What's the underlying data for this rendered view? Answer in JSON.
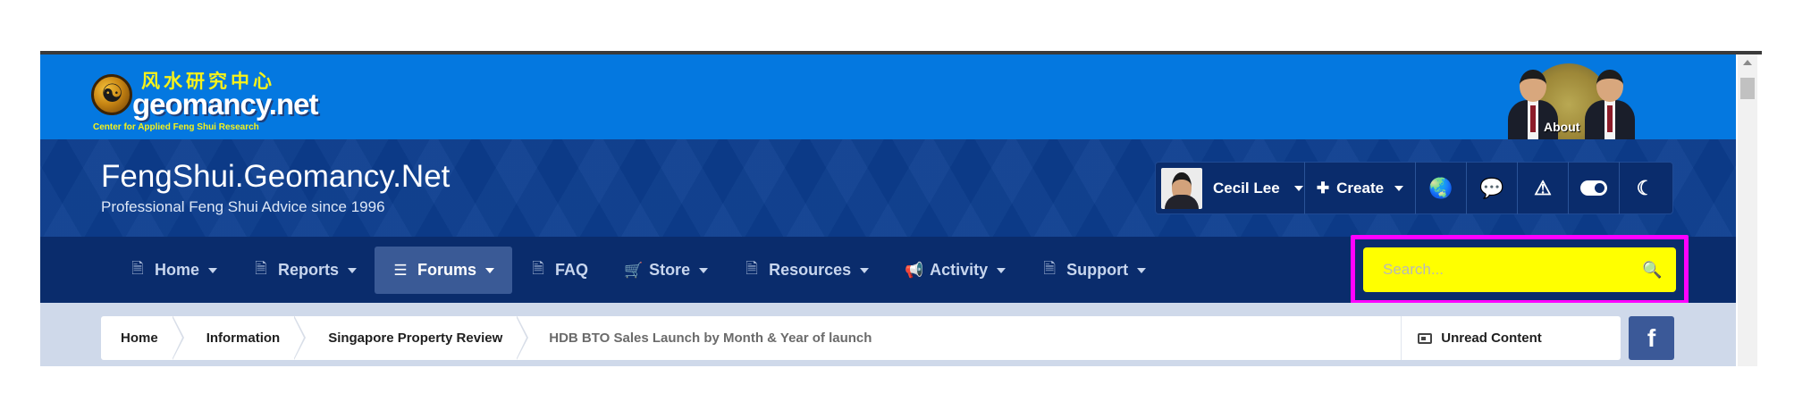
{
  "brand": {
    "logo_cn": "风水研究中心",
    "logo_main": "geomancy.net",
    "logo_sub": "Center for Applied Feng Shui Research",
    "about_label": "About"
  },
  "header": {
    "title": "FengShui.Geomancy.Net",
    "tagline": "Professional Feng Shui Advice since 1996"
  },
  "user_bar": {
    "username": "Cecil Lee",
    "create_label": "Create",
    "icons": [
      "globe-icon",
      "chat-icon",
      "warning-icon",
      "toggle-icon",
      "moon-icon"
    ],
    "globe_glyph": "🌏",
    "chat_glyph": "💬",
    "warning_glyph": "⚠",
    "moon_glyph": "☾",
    "plus_glyph": "✚"
  },
  "nav": {
    "items": [
      {
        "label": "Home",
        "icon": "document-icon",
        "glyph": "🗎",
        "dropdown": true,
        "active": false
      },
      {
        "label": "Reports",
        "icon": "document-icon",
        "glyph": "🗎",
        "dropdown": true,
        "active": false
      },
      {
        "label": "Forums",
        "icon": "list-icon",
        "glyph": "☰",
        "dropdown": true,
        "active": true
      },
      {
        "label": "FAQ",
        "icon": "document-icon",
        "glyph": "🗎",
        "dropdown": false,
        "active": false
      },
      {
        "label": "Store",
        "icon": "cart-icon",
        "glyph": "🛒",
        "dropdown": true,
        "active": false
      },
      {
        "label": "Resources",
        "icon": "document-icon",
        "glyph": "🗎",
        "dropdown": true,
        "active": false
      },
      {
        "label": "Activity",
        "icon": "megaphone-icon",
        "glyph": "📢",
        "dropdown": true,
        "active": false
      },
      {
        "label": "Support",
        "icon": "document-icon",
        "glyph": "🗎",
        "dropdown": true,
        "active": false
      }
    ],
    "search_placeholder": "Search...",
    "search_value": "",
    "search_glyph": "🔍"
  },
  "breadcrumb": {
    "items": [
      "Home",
      "Information",
      "Singapore Property Review"
    ],
    "current": "HDB BTO Sales Launch by Month & Year of launch",
    "unread_label": "Unread Content",
    "facebook_glyph": "f"
  },
  "colors": {
    "brand_bar": "#0478e0",
    "header": "#0c3e8f",
    "nav": "#0a2c6c",
    "search_highlight": "#ff00ff",
    "search_fill": "#ffff00",
    "facebook": "#3b5998"
  }
}
